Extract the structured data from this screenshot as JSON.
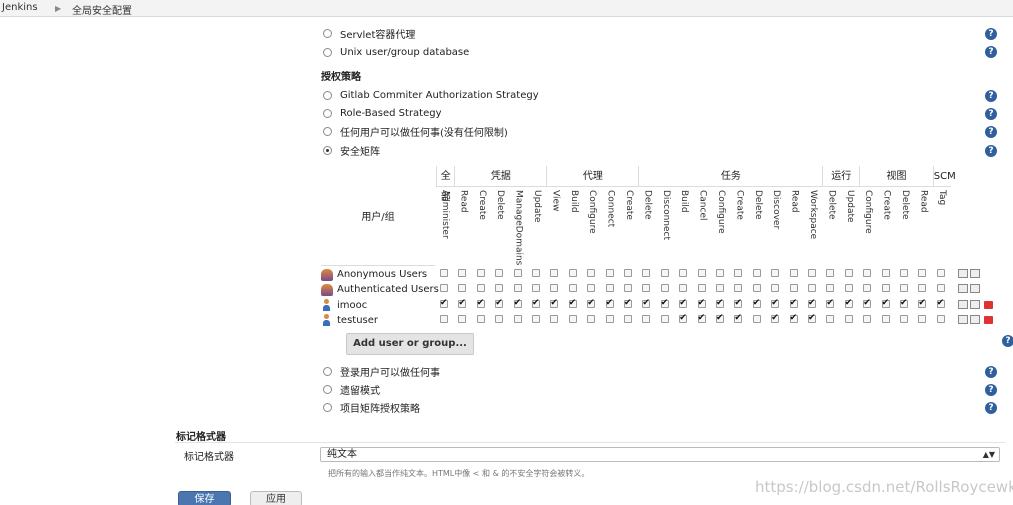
{
  "breadcrumb": [
    "Jenkins",
    "全局安全配置"
  ],
  "security_realm_options": [
    {
      "label": "Servlet容器代理",
      "checked": false
    },
    {
      "label": "Unix user/group database",
      "checked": false
    }
  ],
  "authorization": {
    "heading": "授权策略",
    "options": [
      {
        "label": "Gitlab Commiter Authorization Strategy",
        "checked": false
      },
      {
        "label": "Role-Based Strategy",
        "checked": false
      },
      {
        "label": "任何用户可以做任何事(没有任何限制)",
        "checked": false
      },
      {
        "label": "安全矩阵",
        "checked": true
      }
    ]
  },
  "matrix": {
    "user_header": "用户/组",
    "groups": [
      {
        "label": "全部",
        "span": 1
      },
      {
        "label": "凭据",
        "span": 5
      },
      {
        "label": "代理",
        "span": 5
      },
      {
        "label": "任务",
        "span": 10
      },
      {
        "label": "运行",
        "span": 2
      },
      {
        "label": "视图",
        "span": 4
      },
      {
        "label": "SCM",
        "span": 1
      }
    ],
    "columns": [
      "Administer",
      "Read",
      "Create",
      "Delete",
      "ManageDomains",
      "Update",
      "View",
      "Build",
      "Configure",
      "Connect",
      "Create",
      "Delete",
      "Disconnect",
      "Build",
      "Cancel",
      "Configure",
      "Create",
      "Delete",
      "Discover",
      "Read",
      "Workspace",
      "Delete",
      "Update",
      "Configure",
      "Create",
      "Delete",
      "Read",
      "Tag"
    ],
    "rows": [
      {
        "name": "Anonymous Users",
        "icon": "group-icon",
        "checks": [
          0,
          0,
          0,
          0,
          0,
          0,
          0,
          0,
          0,
          0,
          0,
          0,
          0,
          0,
          0,
          0,
          0,
          0,
          0,
          0,
          0,
          0,
          0,
          0,
          0,
          0,
          0,
          0
        ],
        "deletable": false
      },
      {
        "name": "Authenticated Users",
        "icon": "group-icon",
        "checks": [
          0,
          0,
          0,
          0,
          0,
          0,
          0,
          0,
          0,
          0,
          0,
          0,
          0,
          0,
          0,
          0,
          0,
          0,
          0,
          0,
          0,
          0,
          0,
          0,
          0,
          0,
          0,
          0
        ],
        "deletable": false
      },
      {
        "name": "imooc",
        "icon": "user-icon",
        "checks": [
          1,
          1,
          1,
          1,
          1,
          1,
          1,
          1,
          1,
          1,
          1,
          1,
          1,
          1,
          1,
          1,
          1,
          1,
          1,
          1,
          1,
          1,
          1,
          1,
          1,
          1,
          1,
          1
        ],
        "deletable": true
      },
      {
        "name": "testuser",
        "icon": "user-icon",
        "checks": [
          0,
          0,
          0,
          0,
          0,
          0,
          0,
          0,
          0,
          0,
          0,
          0,
          0,
          1,
          1,
          1,
          1,
          0,
          1,
          1,
          1,
          0,
          0,
          0,
          0,
          0,
          0,
          0
        ],
        "deletable": true
      }
    ]
  },
  "add_button": "Add user or group...",
  "more_auth_options": [
    {
      "label": "登录用户可以做任何事",
      "checked": false
    },
    {
      "label": "遗留模式",
      "checked": false
    },
    {
      "label": "项目矩阵授权策略",
      "checked": false
    }
  ],
  "markup": {
    "section_heading": "标记格式器",
    "field_label": "标记格式器",
    "selected": "纯文本",
    "hint": "把所有的输入都当作纯文本。HTML中像 < 和 & 的不安全字符会被转义。"
  },
  "buttons": {
    "save": "保存",
    "apply": "应用"
  },
  "watermark": "https://blog.csdn.net/RollsRoycewk",
  "colors": {
    "primary": "#4b76b0",
    "help": "#2f5f9c",
    "delete": "#dd3333"
  }
}
